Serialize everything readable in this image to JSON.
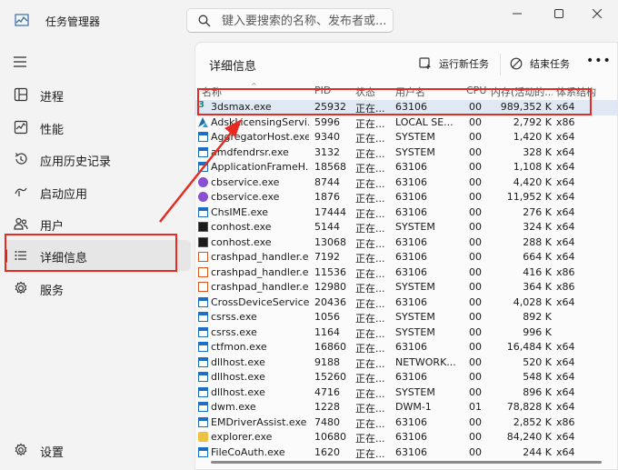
{
  "app": {
    "title": "任务管理器"
  },
  "search": {
    "placeholder": "键入要搜索的名称、发布者或..."
  },
  "sidebar": {
    "items": [
      {
        "label": "进程",
        "icon": "processes-icon"
      },
      {
        "label": "性能",
        "icon": "performance-icon"
      },
      {
        "label": "应用历史记录",
        "icon": "app-history-icon"
      },
      {
        "label": "启动应用",
        "icon": "startup-icon"
      },
      {
        "label": "用户",
        "icon": "users-icon"
      },
      {
        "label": "详细信息",
        "icon": "details-icon"
      },
      {
        "label": "服务",
        "icon": "services-icon"
      }
    ],
    "settings_label": "设置"
  },
  "panel": {
    "title": "详细信息",
    "run_task_label": "运行新任务",
    "end_task_label": "结束任务"
  },
  "table": {
    "columns": [
      "名称",
      "PID",
      "状态",
      "用户名",
      "CPU",
      "内存(活动的...",
      "体系结构"
    ],
    "rows": [
      {
        "name": "3dsmax.exe",
        "pid": "25932",
        "status": "正在...",
        "user": "63106",
        "cpu": "00",
        "mem": "989,352 K",
        "arch": "x64",
        "icon": "3dsmax-icon"
      },
      {
        "name": "AdskLicensingServi...",
        "pid": "5996",
        "status": "正在...",
        "user": "LOCAL SE...",
        "cpu": "00",
        "mem": "2,792 K",
        "arch": "x86",
        "icon": "autodesk-icon"
      },
      {
        "name": "AggregatorHost.exe",
        "pid": "9340",
        "status": "正在...",
        "user": "SYSTEM",
        "cpu": "00",
        "mem": "1,420 K",
        "arch": "x64",
        "icon": "app-icon"
      },
      {
        "name": "amdfendrsr.exe",
        "pid": "3132",
        "status": "正在...",
        "user": "SYSTEM",
        "cpu": "00",
        "mem": "328 K",
        "arch": "x64",
        "icon": "app-icon"
      },
      {
        "name": "ApplicationFrameH...",
        "pid": "18568",
        "status": "正在...",
        "user": "63106",
        "cpu": "00",
        "mem": "1,108 K",
        "arch": "x64",
        "icon": "app-icon"
      },
      {
        "name": "cbservice.exe",
        "pid": "8744",
        "status": "正在...",
        "user": "63106",
        "cpu": "00",
        "mem": "4,420 K",
        "arch": "x64",
        "icon": "cbservice-icon"
      },
      {
        "name": "cbservice.exe",
        "pid": "1876",
        "status": "正在...",
        "user": "63106",
        "cpu": "00",
        "mem": "11,952 K",
        "arch": "x64",
        "icon": "cbservice-icon"
      },
      {
        "name": "ChsIME.exe",
        "pid": "17444",
        "status": "正在...",
        "user": "63106",
        "cpu": "00",
        "mem": "276 K",
        "arch": "x64",
        "icon": "app-icon"
      },
      {
        "name": "conhost.exe",
        "pid": "5144",
        "status": "正在...",
        "user": "SYSTEM",
        "cpu": "00",
        "mem": "324 K",
        "arch": "x64",
        "icon": "console-icon"
      },
      {
        "name": "conhost.exe",
        "pid": "13068",
        "status": "正在...",
        "user": "63106",
        "cpu": "00",
        "mem": "288 K",
        "arch": "x64",
        "icon": "console-icon"
      },
      {
        "name": "crashpad_handler.e...",
        "pid": "7192",
        "status": "正在...",
        "user": "63106",
        "cpu": "00",
        "mem": "664 K",
        "arch": "x64",
        "icon": "crashpad-icon"
      },
      {
        "name": "crashpad_handler.e...",
        "pid": "11536",
        "status": "正在...",
        "user": "63106",
        "cpu": "00",
        "mem": "416 K",
        "arch": "x86",
        "icon": "crashpad-icon"
      },
      {
        "name": "crashpad_handler.e...",
        "pid": "12980",
        "status": "正在...",
        "user": "SYSTEM",
        "cpu": "00",
        "mem": "364 K",
        "arch": "x86",
        "icon": "crashpad-icon"
      },
      {
        "name": "CrossDeviceService....",
        "pid": "20436",
        "status": "正在...",
        "user": "63106",
        "cpu": "00",
        "mem": "4,028 K",
        "arch": "x64",
        "icon": "app-icon"
      },
      {
        "name": "csrss.exe",
        "pid": "1056",
        "status": "正在...",
        "user": "SYSTEM",
        "cpu": "00",
        "mem": "892 K",
        "arch": "",
        "icon": "app-icon"
      },
      {
        "name": "csrss.exe",
        "pid": "1164",
        "status": "正在...",
        "user": "SYSTEM",
        "cpu": "00",
        "mem": "996 K",
        "arch": "",
        "icon": "app-icon"
      },
      {
        "name": "ctfmon.exe",
        "pid": "16860",
        "status": "正在...",
        "user": "63106",
        "cpu": "00",
        "mem": "16,484 K",
        "arch": "x64",
        "icon": "app-icon"
      },
      {
        "name": "dllhost.exe",
        "pid": "9188",
        "status": "正在...",
        "user": "NETWORK...",
        "cpu": "00",
        "mem": "520 K",
        "arch": "x64",
        "icon": "app-icon"
      },
      {
        "name": "dllhost.exe",
        "pid": "15260",
        "status": "正在...",
        "user": "63106",
        "cpu": "00",
        "mem": "548 K",
        "arch": "x64",
        "icon": "app-icon"
      },
      {
        "name": "dllhost.exe",
        "pid": "4716",
        "status": "正在...",
        "user": "SYSTEM",
        "cpu": "00",
        "mem": "896 K",
        "arch": "x64",
        "icon": "app-icon"
      },
      {
        "name": "dwm.exe",
        "pid": "1228",
        "status": "正在...",
        "user": "DWM-1",
        "cpu": "01",
        "mem": "78,828 K",
        "arch": "x64",
        "icon": "app-icon"
      },
      {
        "name": "EMDriverAssist.exe",
        "pid": "7480",
        "status": "正在...",
        "user": "63106",
        "cpu": "00",
        "mem": "2,852 K",
        "arch": "x86",
        "icon": "app-icon"
      },
      {
        "name": "explorer.exe",
        "pid": "10680",
        "status": "正在...",
        "user": "63106",
        "cpu": "00",
        "mem": "84,240 K",
        "arch": "x64",
        "icon": "folder-icon"
      },
      {
        "name": "FileCoAuth.exe",
        "pid": "1620",
        "status": "正在...",
        "user": "63106",
        "cpu": "00",
        "mem": "244 K",
        "arch": "x64",
        "icon": "app-icon"
      }
    ]
  },
  "colors": {
    "accent": "#0067c0",
    "highlight": "#e52b22"
  }
}
